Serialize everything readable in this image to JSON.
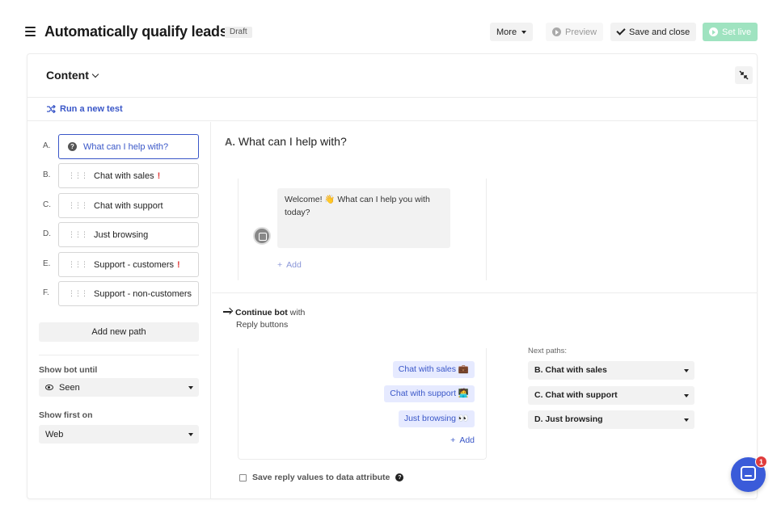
{
  "header": {
    "title": "Automatically qualify leads",
    "status_badge": "Draft",
    "more_label": "More",
    "preview_label": "Preview",
    "save_close_label": "Save and close",
    "set_live_label": "Set live"
  },
  "content": {
    "title": "Content",
    "run_test_label": "Run a new test"
  },
  "paths": [
    {
      "letter": "A.",
      "label": "What can I help with?"
    },
    {
      "letter": "B.",
      "label": "Chat with sales",
      "warning": "!"
    },
    {
      "letter": "C.",
      "label": "Chat with support"
    },
    {
      "letter": "D.",
      "label": "Just browsing"
    },
    {
      "letter": "E.",
      "label": "Support - customers",
      "warning": "!"
    },
    {
      "letter": "F.",
      "label": "Support - non-customers"
    }
  ],
  "add_path_label": "Add new path",
  "show_bot_until": {
    "label": "Show bot until",
    "value": "Seen"
  },
  "show_first_on": {
    "label": "Show first on",
    "value": "Web"
  },
  "editor": {
    "path_letter": "A.",
    "path_title": "What can I help with?",
    "message": "Welcome! 👋 What can I help you with today?",
    "add_label": "Add",
    "continue_bold": "Continue bot",
    "continue_rest": "with",
    "continue_sub": "Reply buttons",
    "reply_buttons": [
      "Chat with sales 💼",
      "Chat with support 🧑‍💻",
      "Just browsing 👀"
    ],
    "reply_add_label": "Add",
    "next_paths_label": "Next paths:",
    "next_paths": [
      "B. Chat with sales",
      "C. Chat with support",
      "D. Just browsing"
    ],
    "save_attr_label": "Save reply values to data attribute"
  },
  "messenger": {
    "badge_count": "1"
  },
  "colors": {
    "accent": "#3a57c8",
    "set_live": "#9fe3c0",
    "warning": "#e03c3c",
    "launcher": "#3a5bd9"
  }
}
